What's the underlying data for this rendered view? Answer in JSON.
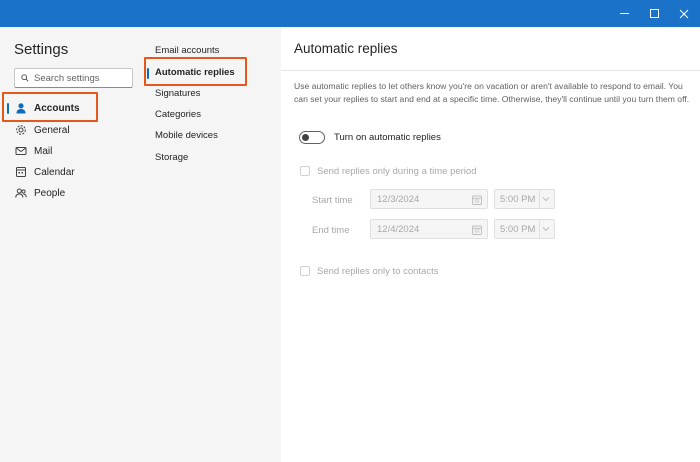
{
  "window": {
    "minimize_icon": "minimize-icon",
    "maximize_icon": "maximize-icon",
    "close_icon": "close-icon",
    "titlebar_color": "#1a73c8"
  },
  "sidebar": {
    "title": "Settings",
    "search_placeholder": "Search settings",
    "items": [
      {
        "label": "Accounts",
        "icon": "person-icon",
        "active": true
      },
      {
        "label": "General",
        "icon": "gear-icon"
      },
      {
        "label": "Mail",
        "icon": "mail-icon"
      },
      {
        "label": "Calendar",
        "icon": "calendar-icon"
      },
      {
        "label": "People",
        "icon": "people-icon"
      }
    ]
  },
  "subnav": {
    "items": [
      {
        "label": "Email accounts"
      },
      {
        "label": "Automatic replies",
        "active": true
      },
      {
        "label": "Signatures"
      },
      {
        "label": "Categories"
      },
      {
        "label": "Mobile devices"
      },
      {
        "label": "Storage"
      }
    ]
  },
  "main": {
    "title": "Automatic replies",
    "description": "Use automatic replies to let others know you're on vacation or aren't available to respond to email. You can set your replies to start and end at a specific time. Otherwise, they'll continue until you turn them off.",
    "toggle_label": "Turn on automatic replies",
    "toggle_on": false,
    "time_period_label": "Send replies only during a time period",
    "start_time_label": "Start time",
    "start_date": "12/3/2024",
    "start_time": "5:00 PM",
    "end_time_label": "End time",
    "end_date": "12/4/2024",
    "end_time": "5:00 PM",
    "contacts_only_label": "Send replies only to contacts"
  },
  "colors": {
    "accent": "#0f6cbd",
    "highlight": "#e4581c"
  }
}
